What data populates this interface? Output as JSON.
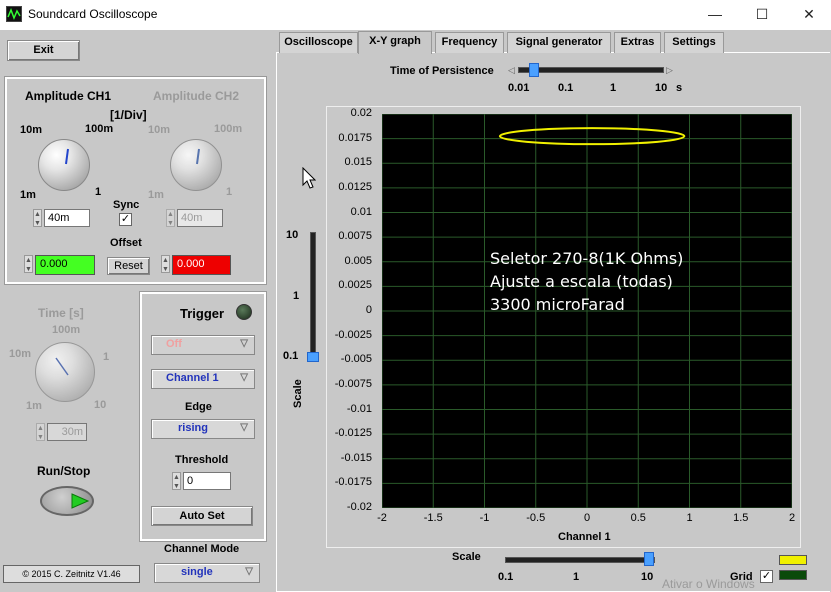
{
  "window": {
    "title": "Soundcard Oscilloscope",
    "min": "—",
    "max": "☐",
    "close": "✕"
  },
  "exit_label": "Exit",
  "amp": {
    "ch1_title": "Amplitude CH1",
    "ch2_title": "Amplitude CH2",
    "unit": "[1/Div]",
    "t10m": "10m",
    "t100m": "100m",
    "t1m": "1m",
    "t1": "1",
    "ch1_value": "40m",
    "ch2_value": "40m",
    "sync": "Sync",
    "offset": "Offset",
    "reset": "Reset",
    "offset_ch1": "0.000",
    "offset_ch2": "0.000"
  },
  "time": {
    "title": "Time [s]",
    "t100m": "100m",
    "t10m": "10m",
    "t1": "1",
    "t1m": "1m",
    "t10": "10",
    "value": "30m"
  },
  "run": {
    "label": "Run/Stop"
  },
  "trigger": {
    "title": "Trigger",
    "mode": "Off",
    "channel": "Channel 1",
    "edge_label": "Edge",
    "edge": "rising",
    "threshold_label": "Threshold",
    "threshold": "0",
    "autoset": "Auto Set"
  },
  "channel_mode": {
    "label": "Channel Mode",
    "value": "single"
  },
  "copyright": "© 2015  C. Zeitnitz V1.46",
  "tabs": [
    "Oscilloscope",
    "X-Y graph",
    "Frequency",
    "Signal generator",
    "Extras",
    "Settings"
  ],
  "persistence": {
    "label": "Time of Persistence",
    "ticks": [
      "0.01",
      "0.1",
      "1",
      "10"
    ],
    "unit": "s"
  },
  "yscale": {
    "label": "Scale",
    "ticks": [
      "10",
      "1",
      "0.1"
    ]
  },
  "xscale": {
    "label": "Scale",
    "ticks": [
      "0.1",
      "1",
      "10"
    ]
  },
  "plot": {
    "xlabel": "Channel 1",
    "yticks": [
      "0.02",
      "0.0175",
      "0.015",
      "0.0125",
      "0.01",
      "0.0075",
      "0.005",
      "0.0025",
      "0",
      "-0.0025",
      "-0.005",
      "-0.0075",
      "-0.01",
      "-0.0125",
      "-0.015",
      "-0.0175",
      "-0.02"
    ],
    "xticks": [
      "-2",
      "-1.5",
      "-1",
      "-0.5",
      "0",
      "0.5",
      "1",
      "1.5",
      "2"
    ],
    "note_line1": "Seletor 270-8(1K Ohms)",
    "note_line2": "Ajuste a escala (todas)",
    "note_line3": "3300 microFarad",
    "trace_color": "#f0f000",
    "grid_color": "#2a5a2a"
  },
  "grid_label": "Grid",
  "watermark": "Ativar o Windows"
}
